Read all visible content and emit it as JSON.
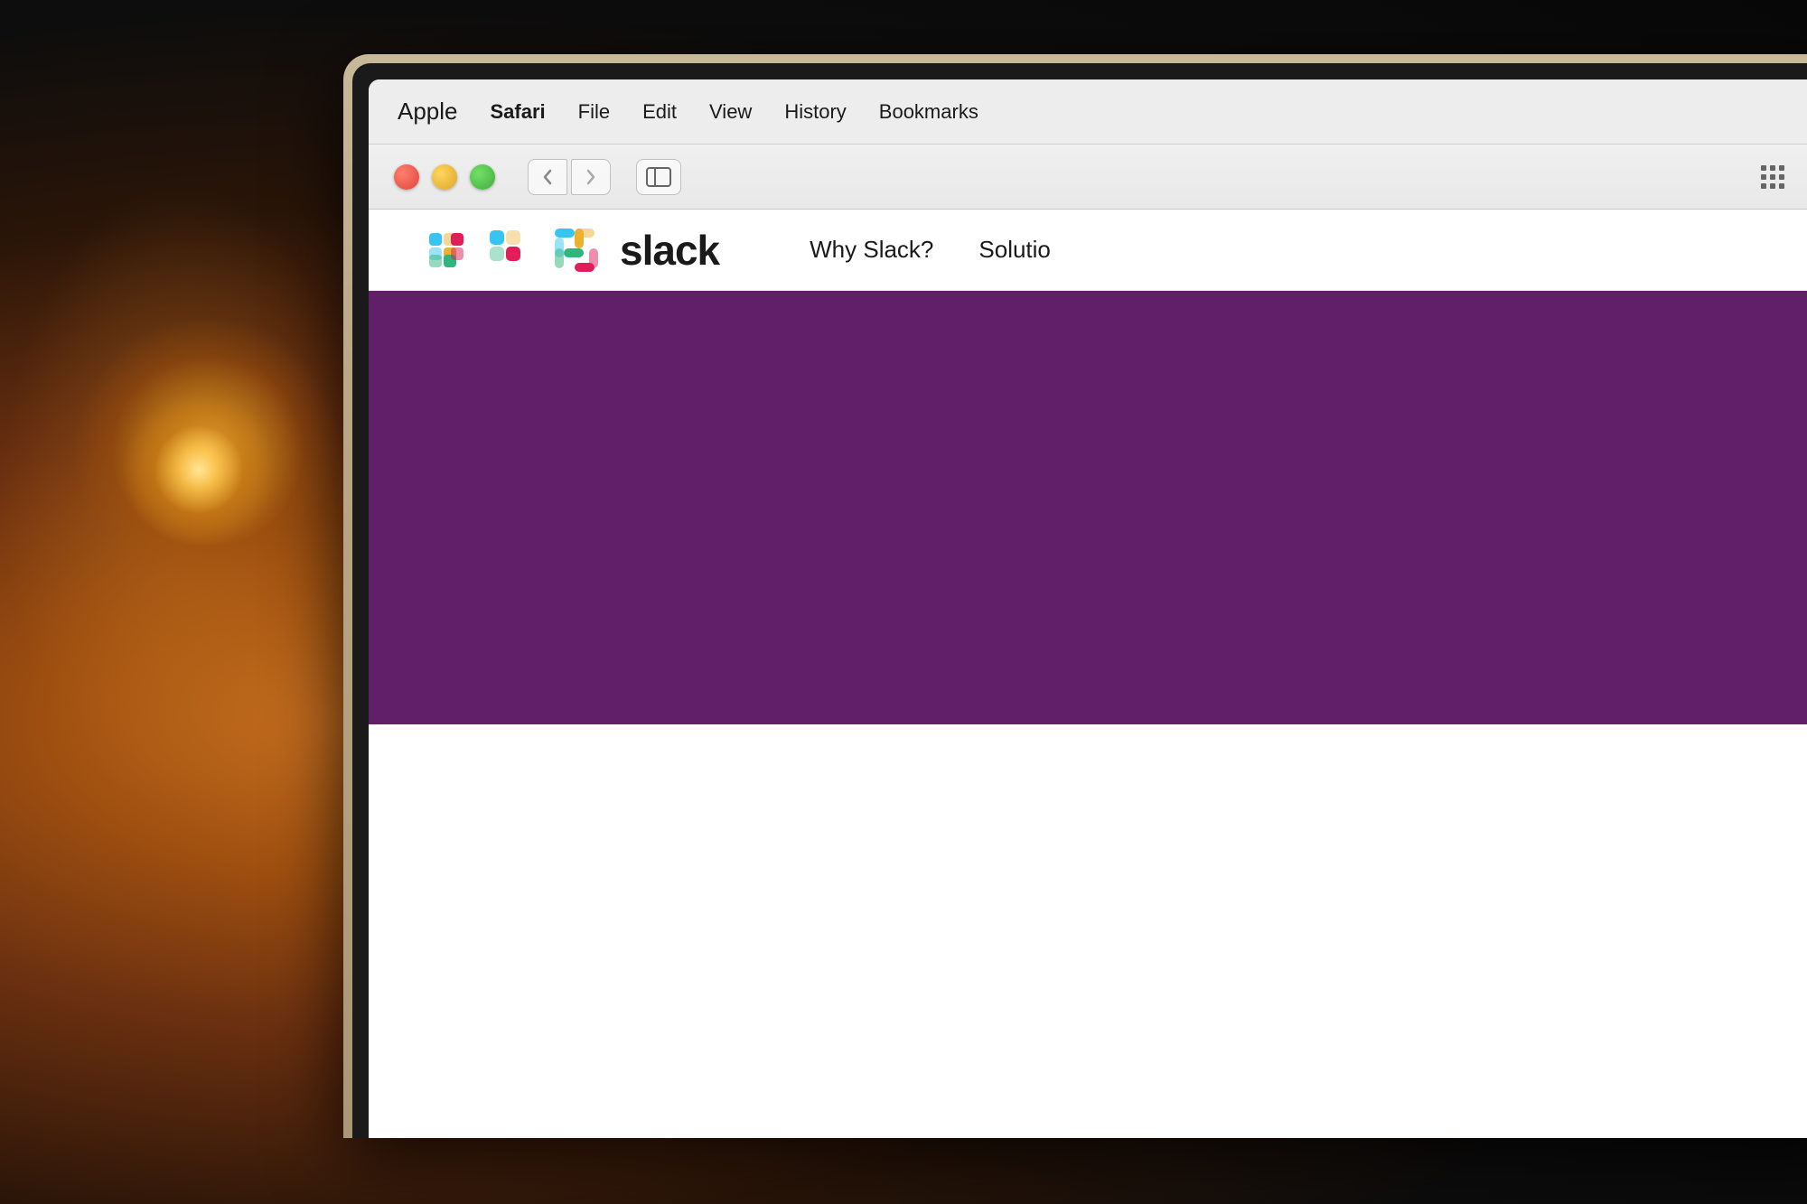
{
  "background": {
    "description": "dark room background with warm incandescent light bulb on left"
  },
  "menubar": {
    "apple_label": "",
    "items": [
      {
        "id": "apple",
        "label": "",
        "bold": false
      },
      {
        "id": "safari",
        "label": "Safari",
        "bold": true
      },
      {
        "id": "file",
        "label": "File",
        "bold": false
      },
      {
        "id": "edit",
        "label": "Edit",
        "bold": false
      },
      {
        "id": "view",
        "label": "View",
        "bold": false
      },
      {
        "id": "history",
        "label": "History",
        "bold": false
      },
      {
        "id": "bookmarks",
        "label": "Bookmarks",
        "bold": false
      }
    ]
  },
  "browser_toolbar": {
    "back_label": "‹",
    "forward_label": "›",
    "traffic_lights": {
      "close_color": "#e0443a",
      "minimize_color": "#dba528",
      "maximize_color": "#3fad38"
    }
  },
  "slack_website": {
    "logo_text": "slack",
    "nav_items": [
      {
        "id": "why-slack",
        "label": "Why Slack?"
      },
      {
        "id": "solutions",
        "label": "Solutio"
      }
    ],
    "hero": {
      "background_color": "#611f69"
    }
  }
}
